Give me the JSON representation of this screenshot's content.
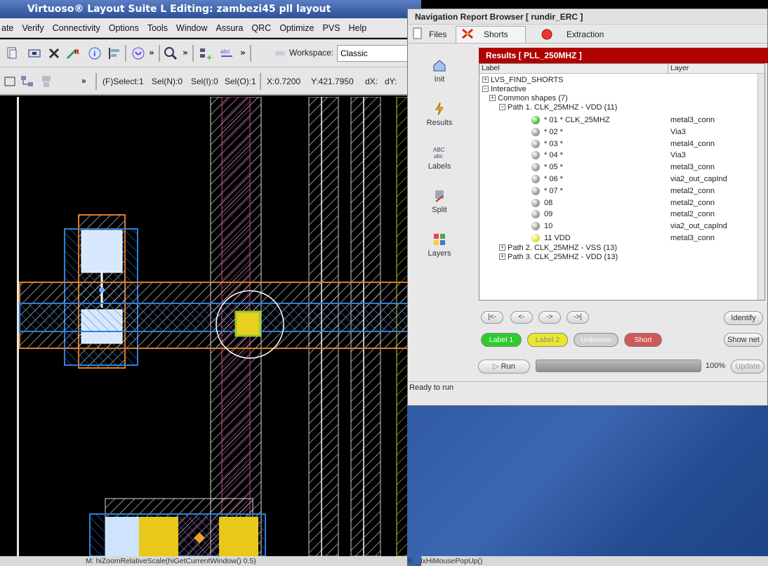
{
  "virtuoso": {
    "title": "Virtuoso® Layout Suite L Editing: zambezi45 pll layout",
    "menu": [
      "ate",
      "Verify",
      "Connectivity",
      "Options",
      "Tools",
      "Window",
      "Assura",
      "QRC",
      "Optimize",
      "PVS",
      "Help"
    ],
    "workspace_label": "Workspace:",
    "workspace_value": "Classic",
    "toolbar2": {
      "select": "(F)Select:1",
      "seln": "Sel(N):0",
      "seli": "Sel(I):0",
      "selo": "Sel(O):1",
      "x": "X:0.7200",
      "y": "Y:421.7950",
      "dx": "dX:",
      "dy": "dY:"
    },
    "status_m": "M: hiZoomRelativeScale(hiGetCurrentWindow() 0.5)",
    "status_r": "R: _lxHiMousePopUp()"
  },
  "nav": {
    "title": "Navigation Report Browser [ rundir_ERC ]",
    "tabs": [
      "Files",
      "Shorts",
      "Extraction"
    ],
    "sidebar": [
      "Init",
      "Results",
      "Labels",
      "Split",
      "Layers"
    ],
    "results_header": "Results  [ PLL_250MHZ ]",
    "col_label": "Label",
    "col_layer": "Layer",
    "tree": {
      "root": "LVS_FIND_SHORTS",
      "interactive": "Interactive",
      "common": "Common shapes (7)",
      "path1": "Path 1. CLK_25MHZ - VDD (11)",
      "items": [
        {
          "label": "* 01 * CLK_25MHZ",
          "layer": "metal3_conn",
          "color": "#3cc23c"
        },
        {
          "label": "* 02 *",
          "layer": "Via3",
          "color": "#9a9a9a"
        },
        {
          "label": "* 03 *",
          "layer": "metal4_conn",
          "color": "#9a9a9a"
        },
        {
          "label": "* 04 *",
          "layer": "Via3",
          "color": "#9a9a9a"
        },
        {
          "label": "* 05 *",
          "layer": "metal3_conn",
          "color": "#9a9a9a"
        },
        {
          "label": "* 06 *",
          "layer": "via2_out_capInd",
          "color": "#9a9a9a"
        },
        {
          "label": "* 07 *",
          "layer": "metal2_conn",
          "color": "#9a9a9a"
        },
        {
          "label": "08",
          "layer": "metal2_conn",
          "color": "#9a9a9a"
        },
        {
          "label": "09",
          "layer": "metal2_conn",
          "color": "#9a9a9a"
        },
        {
          "label": "10",
          "layer": "via2_out_capInd",
          "color": "#9a9a9a"
        },
        {
          "label": "11 VDD",
          "layer": "metal3_conn",
          "color": "#e0e030"
        }
      ],
      "path2": "Path 2. CLK_25MHZ - VSS (13)",
      "path3": "Path 3. CLK_25MHZ - VDD (13)"
    },
    "nav_buttons": [
      "|<-",
      "<-",
      "->",
      "->|"
    ],
    "identify": "Identify",
    "legend": [
      "Label 1",
      "Label 2",
      "Unknown",
      "Short"
    ],
    "show_net": "Show net",
    "run": "Run",
    "progress_percent": 100,
    "progress_text": "100%",
    "update": "Update",
    "status": "Ready to run"
  }
}
